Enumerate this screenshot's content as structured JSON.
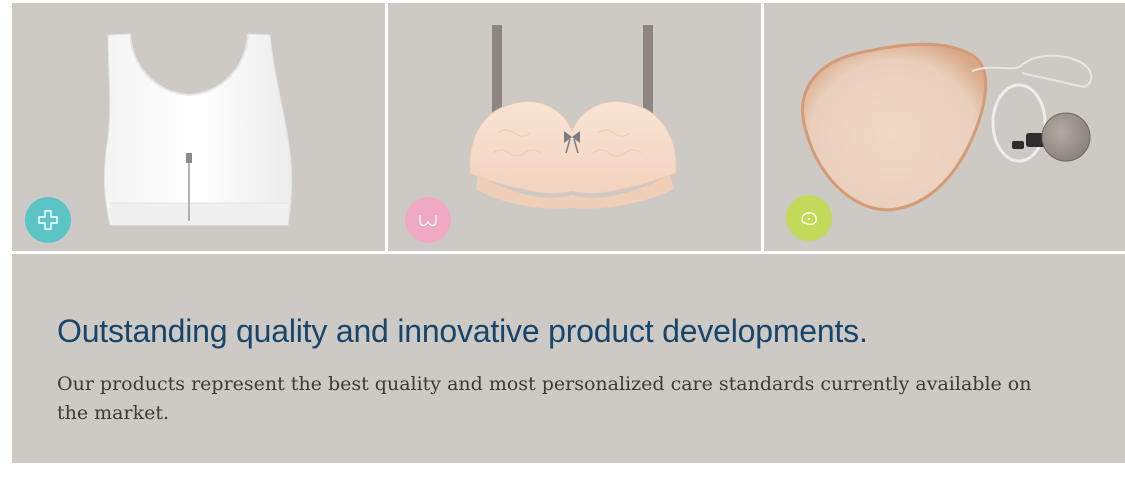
{
  "tiles": [
    {
      "product": "post-surgical front-zip bra",
      "icon": "medical-cross-icon",
      "badge_color": "#5bc4c4"
    },
    {
      "product": "lace mastectomy bra",
      "icon": "bra-icon",
      "badge_color": "#efa9c3"
    },
    {
      "product": "breast form with adjustment pump",
      "icon": "breast-form-icon",
      "badge_color": "#c3d95a"
    }
  ],
  "content": {
    "headline": "Outstanding quality and innovative product developments.",
    "body": "Our products represent the best quality and most personalized care standards currently available on the market."
  },
  "colors": {
    "panel_background": "#cdc9c4",
    "headline": "#17456b",
    "body_text": "#3b3b3b"
  }
}
